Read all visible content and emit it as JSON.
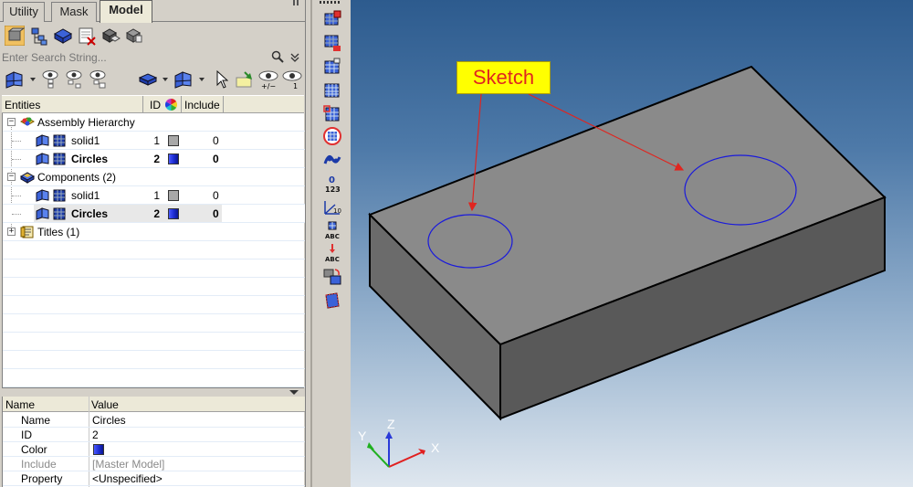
{
  "tabs": [
    {
      "label": "Utility"
    },
    {
      "label": "Mask"
    },
    {
      "label": "Model"
    }
  ],
  "search": {
    "placeholder": "Enter Search String..."
  },
  "entities_header": {
    "entities": "Entities",
    "id": "ID",
    "include": "Include"
  },
  "tree": {
    "assembly": {
      "label": "Assembly Hierarchy"
    },
    "assembly_children": [
      {
        "name": "solid1",
        "id": "1",
        "color": "#a8a8a8",
        "include": "0"
      },
      {
        "name": "Circles",
        "id": "2",
        "color": "#1f2fd6",
        "include": "0"
      }
    ],
    "components": {
      "label": "Components (2)"
    },
    "components_children": [
      {
        "name": "solid1",
        "id": "1",
        "color": "#a8a8a8",
        "include": "0"
      },
      {
        "name": "Circles",
        "id": "2",
        "color": "#1f2fd6",
        "include": "0"
      }
    ],
    "titles": {
      "label": "Titles (1)"
    }
  },
  "props": {
    "header": {
      "name": "Name",
      "value": "Value"
    },
    "rows": [
      {
        "key": "Name",
        "value": "Circles"
      },
      {
        "key": "ID",
        "value": "2"
      },
      {
        "key": "Color",
        "value": "",
        "color": "#1f2fd6"
      },
      {
        "key": "Include",
        "value": "[Master Model]"
      },
      {
        "key": "Property",
        "value": "<Unspecified>"
      }
    ]
  },
  "viewport": {
    "callout": "Sketch",
    "triad": {
      "x": "X",
      "y": "Y",
      "z": "Z"
    },
    "colors": {
      "annotation": "#e0251f",
      "sketch": "#1a1adc",
      "callout_bg": "#ffff00"
    }
  },
  "icons": {
    "toolbar_row1": [
      "component-view-icon",
      "hierarchy-view-icon",
      "solid-view-icon",
      "delete-view-icon",
      "assembly-view-icon",
      "display-view-icon"
    ],
    "toolbar_row2": [
      "entity-select-icon",
      "show-icon",
      "hide-icon",
      "isolate-icon",
      "solid-dropdown-icon",
      "component-dropdown-icon",
      "pointer-icon",
      "highlight-icon",
      "eye-plus-minus-icon",
      "eye-one-icon"
    ],
    "vertical_toolbar": [
      "surface-edit-icon",
      "surface-delete-icon",
      "mesh-icon",
      "grid-icon",
      "tolerance-icon",
      "circle-check-icon",
      "node-icon",
      "number-123-icon",
      "ruler-10-icon",
      "label-abc-icon",
      "label-abc-red-icon",
      "surface-transform-icon",
      "surface-box-icon"
    ]
  }
}
